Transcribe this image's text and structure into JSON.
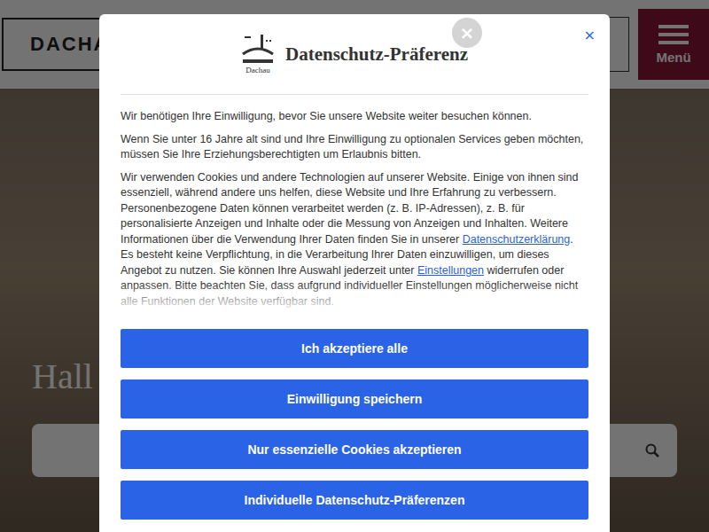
{
  "header": {
    "logo": "DACHA",
    "menu": "Menü"
  },
  "hero": {
    "heading": "Hall"
  },
  "dialog": {
    "title": "Datenschutz-Präferenz",
    "logo_caption": "Dachau",
    "close": "×",
    "close_small": "×",
    "paragraphs": [
      [
        {
          "text": "Wir benötigen Ihre Einwilligung, bevor Sie unsere Website weiter besuchen können.",
          "link": false
        }
      ],
      [
        {
          "text": "Wenn Sie unter 16 Jahre alt sind und Ihre Einwilligung zu optionalen Services geben möchten, müssen Sie Ihre Erziehungsberechtigten um Erlaubnis bitten.",
          "link": false
        }
      ],
      [
        {
          "text": "Wir verwenden Cookies und andere Technologien auf unserer Website. Einige von ihnen sind essenziell, während andere uns helfen, diese Website und Ihre Erfahrung zu verbessern. Personenbezogene Daten können verarbeitet werden (z. B. IP-Adressen), z. B. für personalisierte Anzeigen und Inhalte oder die Messung von Anzeigen und Inhalten. Weitere Informationen über die Verwendung Ihrer Daten finden Sie in unserer ",
          "link": false
        },
        {
          "text": "Datenschutzerklärung",
          "link": true
        },
        {
          "text": ". Es besteht keine Verpflichtung, in die Verarbeitung Ihrer Daten einzuwilligen, um dieses Angebot zu nutzen. Sie können Ihre Auswahl jederzeit unter ",
          "link": false
        },
        {
          "text": "Einstellungen",
          "link": true
        },
        {
          "text": " widerrufen oder anpassen. Bitte beachten Sie, dass aufgrund individueller Einstellungen möglicherweise nicht alle Funktionen der Website verfügbar sind.",
          "link": false
        }
      ]
    ],
    "buttons": [
      "Ich akzeptiere alle",
      "Einwilligung speichern",
      "Nur essenzielle Cookies akzeptieren",
      "Individuelle Datenschutz-Präferenzen"
    ]
  }
}
